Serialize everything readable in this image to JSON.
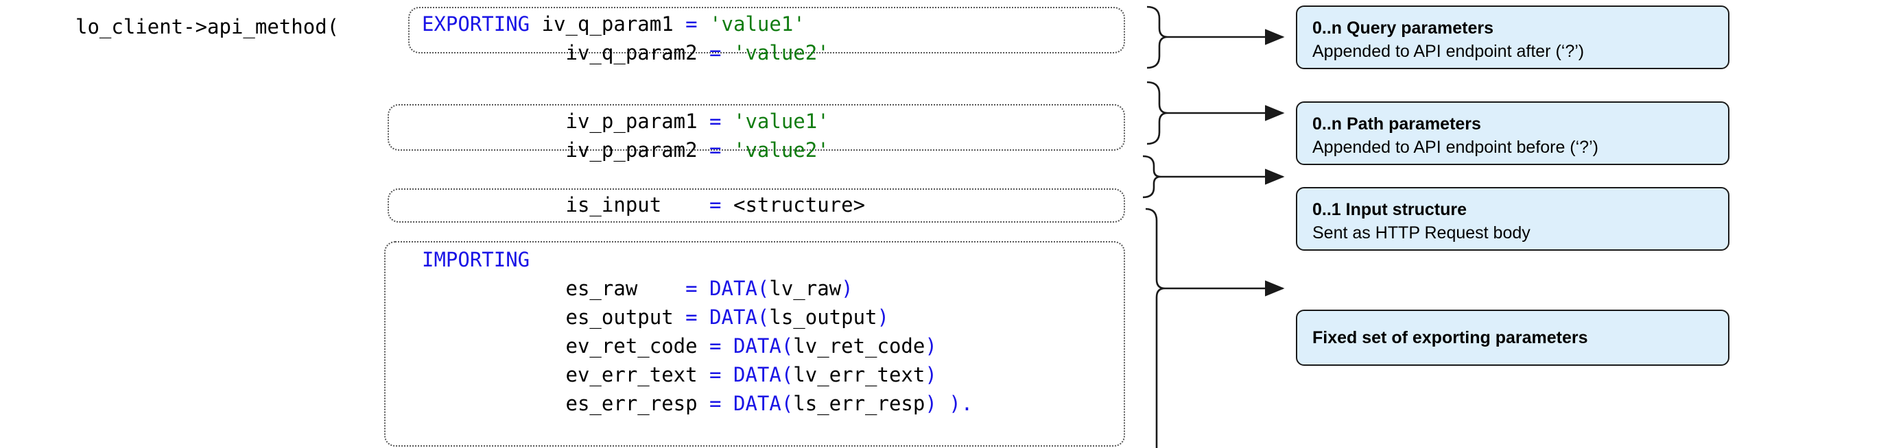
{
  "diagram": {
    "title": "ABAP API client method call parameter mapping",
    "call_prefix": "lo_client->api_method(",
    "colors": {
      "keyword": "#1a14e6",
      "string": "#107c10",
      "text": "#000000",
      "callout_fill": "#ddeffb",
      "callout_border": "#1a1a1a",
      "code_border": "#555555"
    }
  },
  "code_blocks": [
    {
      "id": "query-params",
      "keyword": "EXPORTING",
      "lines": [
        {
          "name": "iv_q_param1",
          "eq": "=",
          "value": "'value1'",
          "value_kind": "string"
        },
        {
          "name": "iv_q_param2",
          "eq": "=",
          "value": "'value2'",
          "value_kind": "string"
        }
      ]
    },
    {
      "id": "path-params",
      "keyword": "",
      "lines": [
        {
          "name": "iv_p_param1",
          "eq": "=",
          "value": "'value1'",
          "value_kind": "string"
        },
        {
          "name": "iv_p_param2",
          "eq": "=",
          "value": "'value2'",
          "value_kind": "string"
        }
      ]
    },
    {
      "id": "input-structure",
      "keyword": "",
      "lines": [
        {
          "name": "is_input",
          "eq": "=",
          "value": "<structure>",
          "value_kind": "text"
        }
      ]
    },
    {
      "id": "importing-params",
      "keyword": "IMPORTING",
      "lines": [
        {
          "name": "es_raw",
          "eq": "=",
          "value": "DATA(lv_raw)",
          "value_kind": "data",
          "inner": "lv_raw"
        },
        {
          "name": "es_output",
          "eq": "=",
          "value": "DATA(ls_output)",
          "value_kind": "data",
          "inner": "ls_output"
        },
        {
          "name": "ev_ret_code",
          "eq": "=",
          "value": "DATA(lv_ret_code)",
          "value_kind": "data",
          "inner": "lv_ret_code"
        },
        {
          "name": "ev_err_text",
          "eq": "=",
          "value": "DATA(lv_err_text)",
          "value_kind": "data",
          "inner": "lv_err_text"
        },
        {
          "name": "es_err_resp",
          "eq": "=",
          "value": "DATA(ls_err_resp) ).",
          "value_kind": "data",
          "inner": "ls_err_resp",
          "closing": " )."
        }
      ]
    }
  ],
  "code_tokens": {
    "exporting": "EXPORTING",
    "importing": "IMPORTING",
    "data_open": "DATA(",
    "paren_close": ")",
    "final_close": " ).",
    "equals": "=",
    "q_param1_name": "iv_q_param1",
    "q_param2_name": "iv_q_param2",
    "q_param1_value": "'value1'",
    "q_param2_value": "'value2'",
    "p_param1_name": "iv_p_param1",
    "p_param2_name": "iv_p_param2",
    "p_param1_value": "'value1'",
    "p_param2_value": "'value2'",
    "input_name": "is_input",
    "input_value": "<structure>",
    "imp1_name": "es_raw",
    "imp1_inner": "lv_raw",
    "imp2_name": "es_output",
    "imp2_inner": "ls_output",
    "imp3_name": "ev_ret_code",
    "imp3_inner": "lv_ret_code",
    "imp4_name": "ev_err_text",
    "imp4_inner": "lv_err_text",
    "imp5_name": "es_err_resp",
    "imp5_inner": "ls_err_resp"
  },
  "callouts": [
    {
      "id": "callout-query",
      "title": "0..n Query parameters",
      "subtitle": "Appended to API endpoint after (‘?’)"
    },
    {
      "id": "callout-path",
      "title": "0..n Path parameters",
      "subtitle": "Appended to API endpoint before (‘?’)"
    },
    {
      "id": "callout-input",
      "title": "0..1 Input structure",
      "subtitle": "Sent as HTTP Request body"
    },
    {
      "id": "callout-exporting",
      "title": "Fixed set of exporting parameters",
      "subtitle": ""
    }
  ]
}
